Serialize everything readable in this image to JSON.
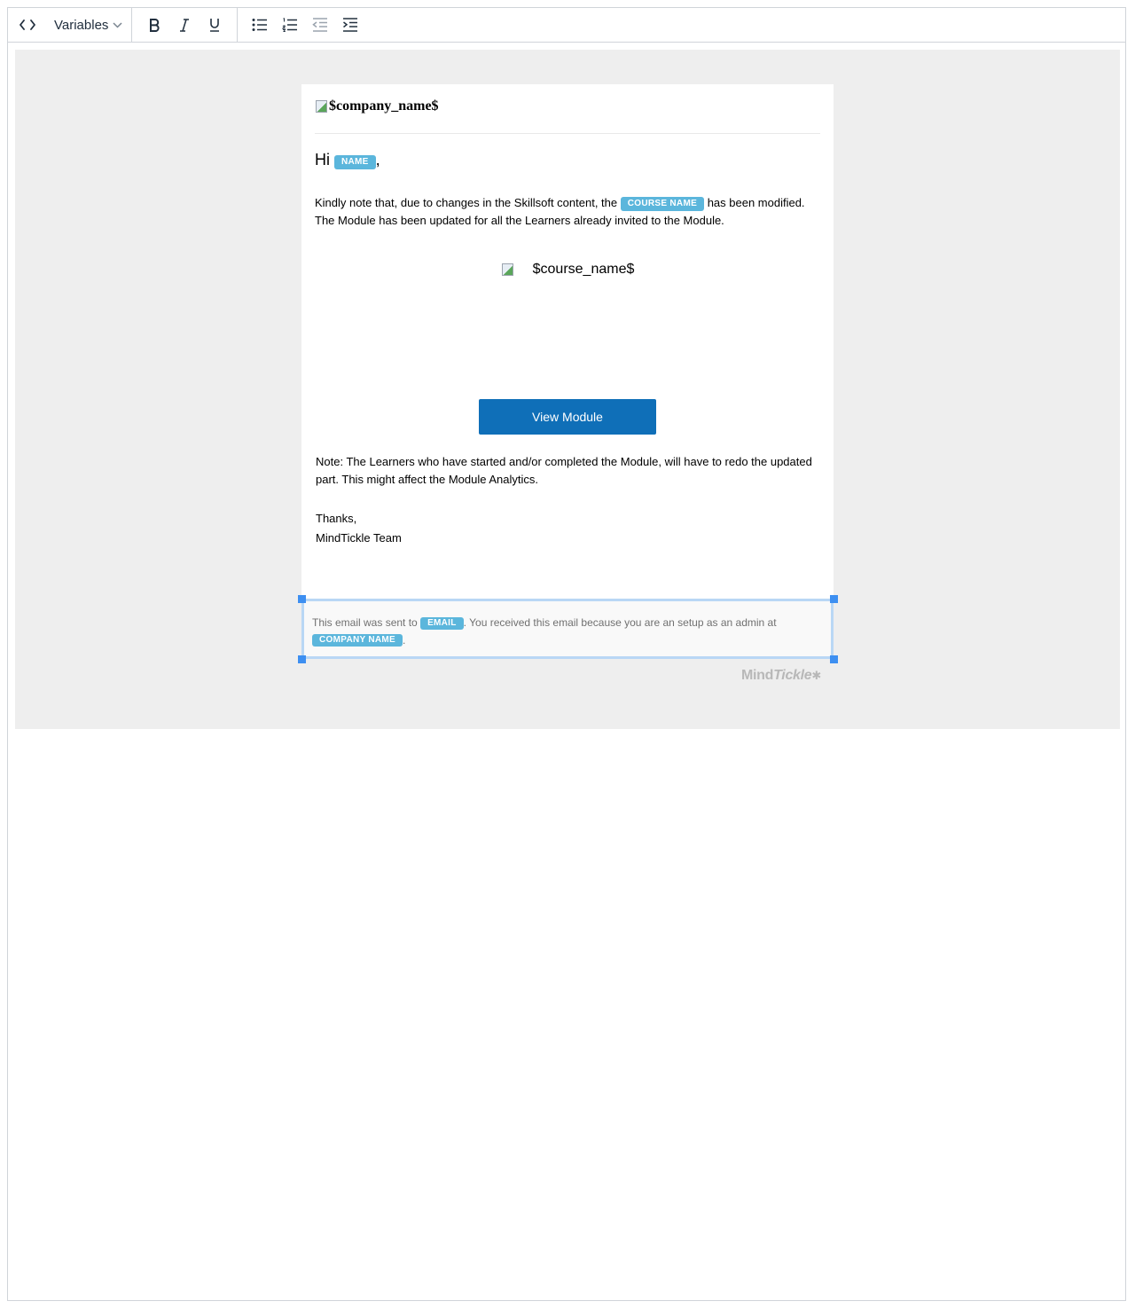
{
  "toolbar": {
    "variables_label": "Variables",
    "buttons": [
      "source-code",
      "bold",
      "italic",
      "underline",
      "bullet-list",
      "numbered-list",
      "outdent",
      "indent"
    ]
  },
  "email": {
    "logo_alt": "$company_name$",
    "greeting_prefix": "Hi",
    "greeting_tag": "NAME",
    "greeting_suffix": ",",
    "para_text_1": "Kindly note that, due to changes in the Skillsoft content, the",
    "para_tag": "COURSE NAME",
    "para_text_2": "has been modified. The Module has been updated for all the Learners already invited to the Module.",
    "course_image_alt": "$course_name$",
    "cta_label": "View Module",
    "note": "Note: The Learners who have started and/or completed the Module, will have to redo the updated part. This might affect the Module Analytics.",
    "thanks": "Thanks,",
    "signature": "MindTickle Team"
  },
  "footer": {
    "text_1": "This email was sent to",
    "email_tag": "EMAIL",
    "text_2": ". You received this email because you are an setup as an admin at",
    "company_tag": "COMPANY NAME",
    "text_3": "."
  },
  "branding": {
    "mind": "Mind",
    "tickle": "Tickle"
  },
  "colors": {
    "tag_bg": "#5bb6dc",
    "cta_bg": "#0f6fb8",
    "canvas_bg": "#eeeeee",
    "selection": "#3d8ff1"
  }
}
